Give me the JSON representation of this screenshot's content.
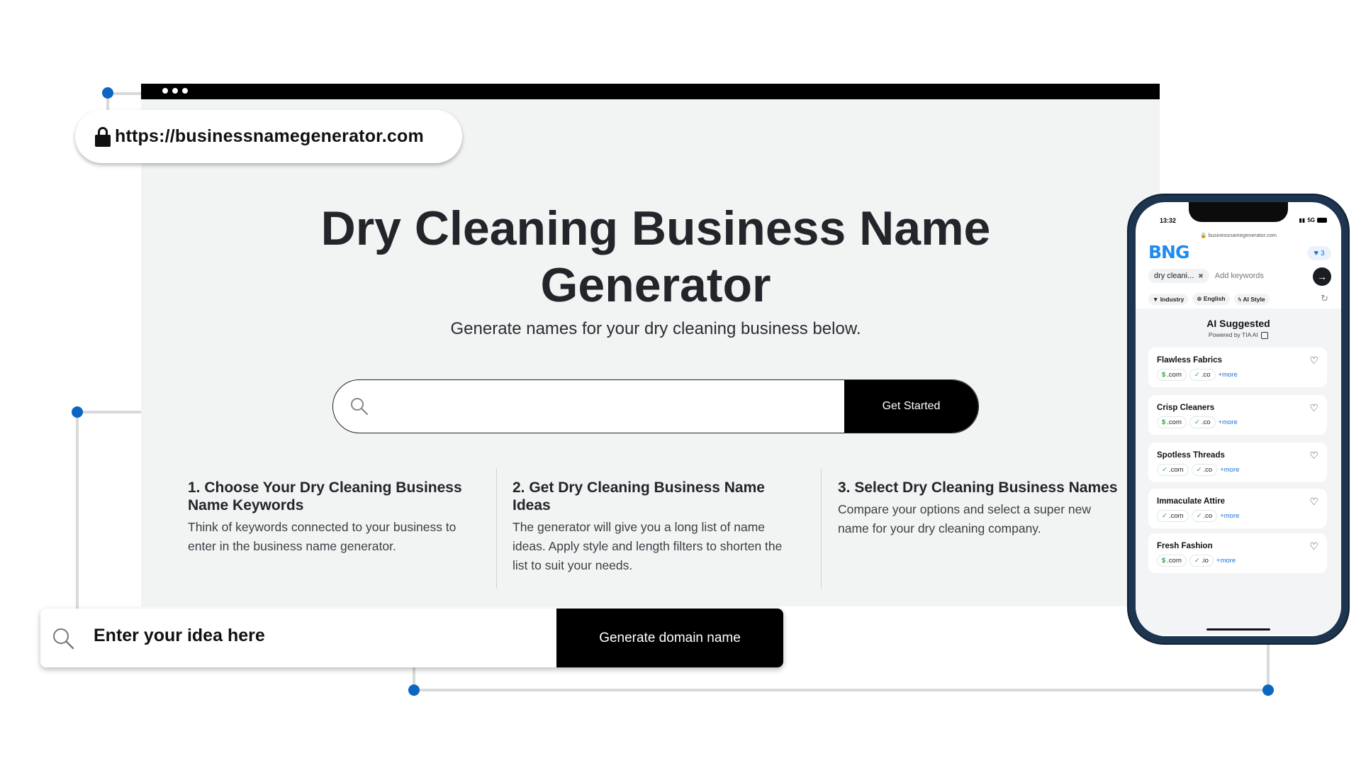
{
  "browser": {
    "url": "https://businessnamegenerator.com"
  },
  "hero": {
    "title": "Dry Cleaning Business Name Generator",
    "subtitle": "Generate names for your dry cleaning business below."
  },
  "search": {
    "placeholder": "",
    "button_label": "Get Started"
  },
  "steps": [
    {
      "title": "1. Choose Your Dry Cleaning Business Name Keywords",
      "text": "Think of keywords connected to your business to enter in the business name generator."
    },
    {
      "title": "2. Get Dry Cleaning Business Name Ideas",
      "text": "The generator will give you a long list of name ideas. Apply style and length filters to shorten the list to suit your needs."
    },
    {
      "title": "3. Select Dry Cleaning Business Names",
      "text": "Compare your options and select a super new name for your dry cleaning company."
    }
  ],
  "idea_bar": {
    "text": "Enter your idea here",
    "button_label": "Generate domain name"
  },
  "phone": {
    "time": "13:32",
    "network": "5G",
    "url": "businessnamegenerator.com",
    "logo": "BNG",
    "favorites_count": "3",
    "keyword_chip": "dry cleani...",
    "keyword_placeholder": "Add keywords",
    "filters": {
      "industry": "Industry",
      "language": "English",
      "ai_style": "AI Style"
    },
    "ai_title": "AI Suggested",
    "ai_powered": "Powered by TIA AI",
    "results": [
      {
        "name": "Flawless Fabrics",
        "tld1": ".com",
        "tld2": ".co",
        "more": "+more"
      },
      {
        "name": "Crisp Cleaners",
        "tld1": ".com",
        "tld2": ".co",
        "more": "+more"
      },
      {
        "name": "Spotless Threads",
        "tld1": ".com",
        "tld2": ".co",
        "more": "+more"
      },
      {
        "name": "Immaculate Attire",
        "tld1": ".com",
        "tld2": ".co",
        "more": "+more"
      },
      {
        "name": "Fresh Fashion",
        "tld1": ".com",
        "tld2": ".io",
        "more": "+more"
      }
    ]
  },
  "colors": {
    "accent_blue": "#0a66c2",
    "logo_blue": "#1d8cf0",
    "button_black": "#000000",
    "page_bg": "#f2f3f3"
  }
}
